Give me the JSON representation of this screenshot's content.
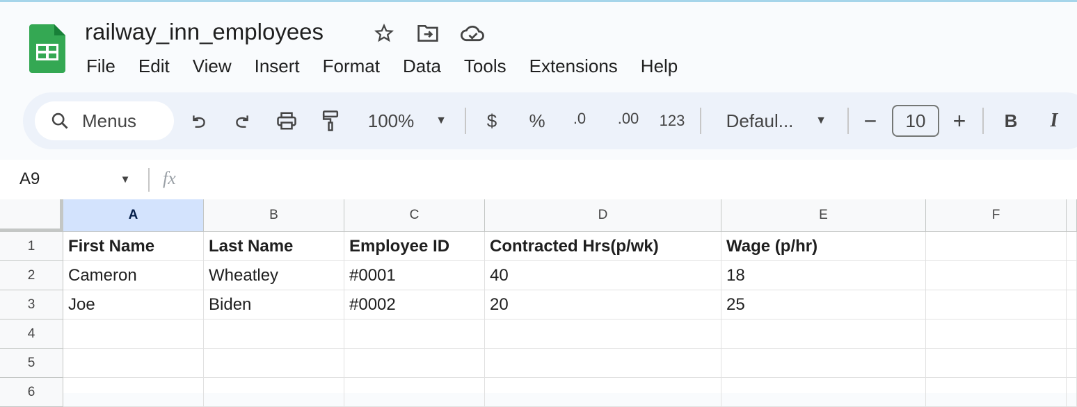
{
  "doc": {
    "title": "railway_inn_employees"
  },
  "menu": [
    "File",
    "Edit",
    "View",
    "Insert",
    "Format",
    "Data",
    "Tools",
    "Extensions",
    "Help"
  ],
  "toolbar": {
    "search": "Menus",
    "zoom": "100%",
    "currency": "$",
    "percent": "%",
    "dec_decrease": ".0",
    "dec_increase": ".00",
    "more_formats": "123",
    "font": "Defaul...",
    "font_size": "10",
    "bold": "B",
    "italic": "I"
  },
  "formula_bar": {
    "cell_ref": "A9",
    "fx": "fx",
    "value": ""
  },
  "columns": [
    "A",
    "B",
    "C",
    "D",
    "E",
    "F"
  ],
  "rows": [
    [
      "First Name",
      "Last Name",
      "Employee ID",
      "Contracted Hrs(p/wk)",
      "Wage (p/hr)",
      ""
    ],
    [
      "Cameron",
      "Wheatley",
      "#0001",
      "40",
      "18",
      ""
    ],
    [
      "Joe",
      "Biden",
      "#0002",
      "20",
      "25",
      ""
    ],
    [
      "",
      "",
      "",
      "",
      "",
      ""
    ],
    [
      "",
      "",
      "",
      "",
      "",
      ""
    ],
    [
      "",
      "",
      "",
      "",
      "",
      ""
    ]
  ],
  "selected_column": "A",
  "colors": {
    "accent": "#0b57d0",
    "header_selected": "#d3e3fd",
    "sheets_green": "#34a853"
  }
}
